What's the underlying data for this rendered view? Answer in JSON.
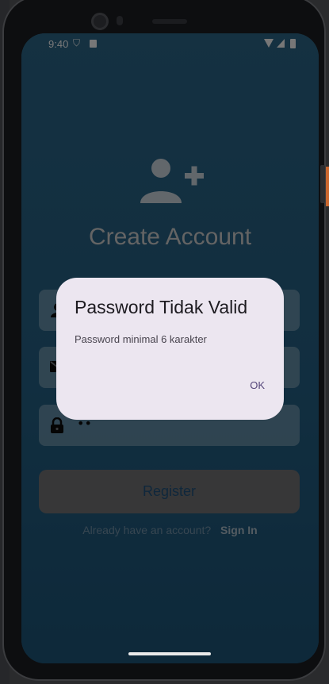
{
  "status_bar": {
    "time": "9:40"
  },
  "register": {
    "title": "Create Account",
    "password_value": "••",
    "register_label": "Register",
    "footer_question": "Already have an account?",
    "footer_link": "Sign In"
  },
  "dialog": {
    "title": "Password Tidak Valid",
    "message": "Password minimal 6 karakter",
    "ok_label": "OK"
  }
}
